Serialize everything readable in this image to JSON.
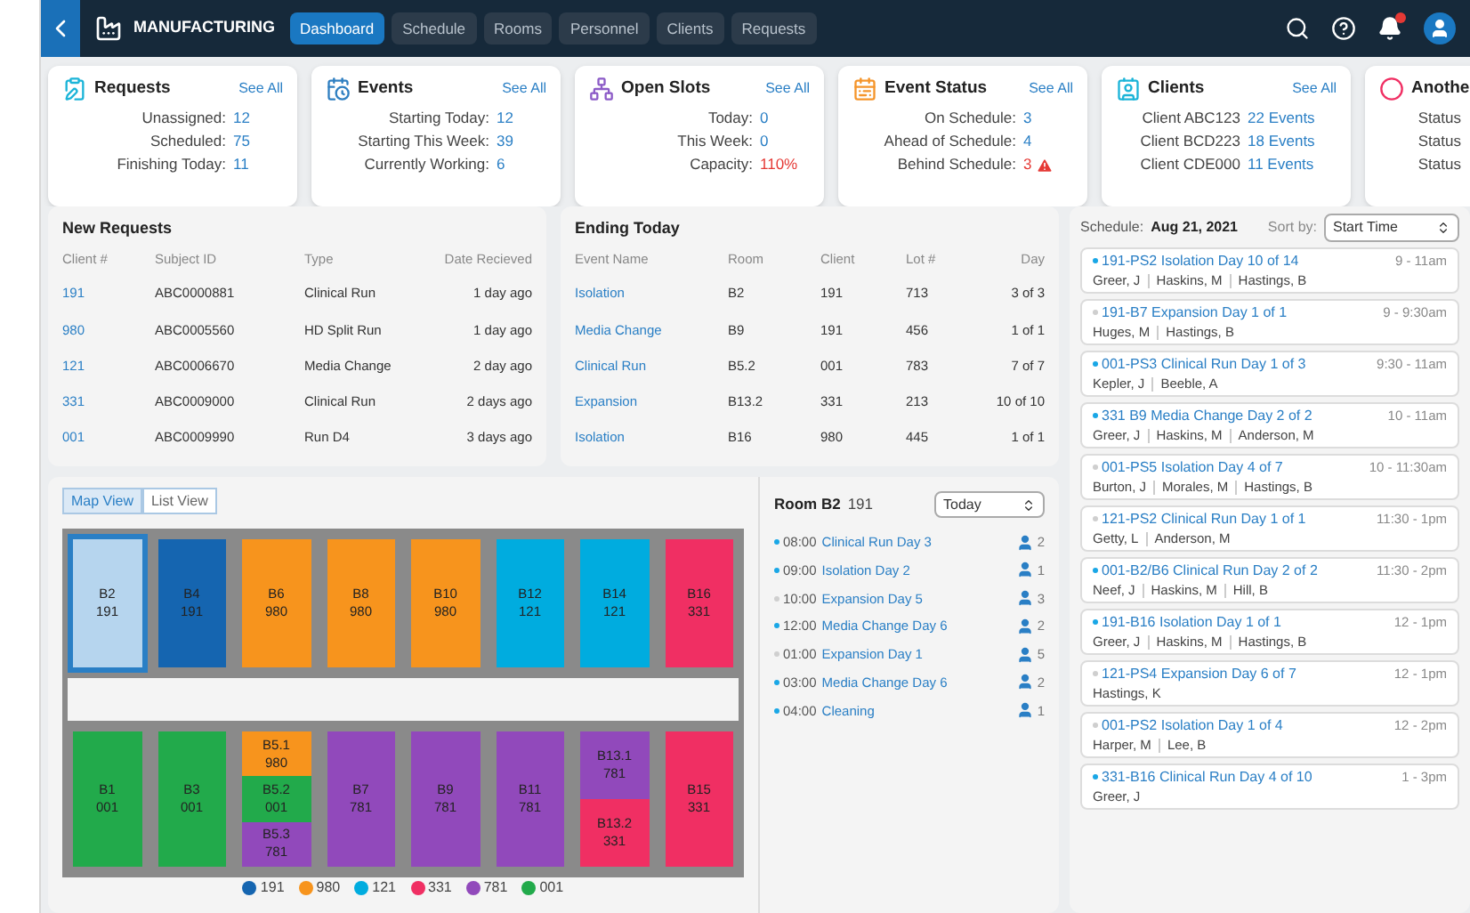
{
  "topbar": {
    "app_name": "MANUFACTURING",
    "tabs": [
      {
        "label": "Dashboard",
        "selected": true
      },
      {
        "label": "Schedule",
        "selected": false
      },
      {
        "label": "Rooms",
        "selected": false
      },
      {
        "label": "Personnel",
        "selected": false
      },
      {
        "label": "Clients",
        "selected": false
      },
      {
        "label": "Requests",
        "selected": false
      }
    ],
    "notification": true
  },
  "cards": [
    {
      "kind": "requests",
      "title": "Requests",
      "link": "See All",
      "rows": [
        {
          "label": "Unassigned:",
          "value": "12",
          "alert": false,
          "warning": false
        },
        {
          "label": "Scheduled:",
          "value": "75",
          "alert": false,
          "warning": false
        },
        {
          "label": "Finishing Today:",
          "value": "11",
          "alert": false,
          "warning": false
        }
      ]
    },
    {
      "kind": "events",
      "title": "Events",
      "link": "See All",
      "rows": [
        {
          "label": "Starting Today:",
          "value": "12",
          "alert": false,
          "warning": false
        },
        {
          "label": "Starting This Week:",
          "value": "39",
          "alert": false,
          "warning": false
        },
        {
          "label": "Currently Working:",
          "value": "6",
          "alert": false,
          "warning": false
        }
      ]
    },
    {
      "kind": "slots",
      "title": "Open Slots",
      "link": "See All",
      "rows": [
        {
          "label": "Today:",
          "value": "0",
          "alert": false,
          "warning": false
        },
        {
          "label": "This Week:",
          "value": "0",
          "alert": false,
          "warning": false
        },
        {
          "label": "Capacity:",
          "value": "110%",
          "alert": true,
          "warning": false
        }
      ]
    },
    {
      "kind": "status",
      "title": "Event Status",
      "link": "See All",
      "rows": [
        {
          "label": "On Schedule:",
          "value": "3",
          "alert": false,
          "warning": false
        },
        {
          "label": "Ahead of Schedule:",
          "value": "4",
          "alert": false,
          "warning": false
        },
        {
          "label": "Behind Schedule:",
          "value": "3",
          "alert": true,
          "warning": true
        }
      ]
    },
    {
      "kind": "clients",
      "title": "Clients",
      "link": "See All",
      "rows": [
        {
          "label": "Client ABC123",
          "value": "22 Events",
          "alert": false,
          "warning": false
        },
        {
          "label": "Client BCD223",
          "value": "18 Events",
          "alert": false,
          "warning": false
        },
        {
          "label": "Client CDE000",
          "value": "11 Events",
          "alert": false,
          "warning": false
        }
      ]
    },
    {
      "kind": "other",
      "title": "Anothe",
      "rows": [
        {
          "label": "Status"
        },
        {
          "label": "Status"
        },
        {
          "label": "Status"
        }
      ]
    }
  ],
  "new_requests": {
    "title": "New Requests",
    "columns": [
      "Client #",
      "Subject ID",
      "Type",
      "Date Recieved"
    ],
    "rows": [
      [
        "191",
        "ABC0000881",
        "Clinical Run",
        "1 day ago"
      ],
      [
        "980",
        "ABC0005560",
        "HD Split Run",
        "1 day ago"
      ],
      [
        "121",
        "ABC0006670",
        "Media Change",
        "2 day ago"
      ],
      [
        "331",
        "ABC0009000",
        "Clinical Run",
        "2 days ago"
      ],
      [
        "001",
        "ABC0009990",
        "Run D4",
        "3 days ago"
      ]
    ]
  },
  "ending_today": {
    "title": "Ending Today",
    "columns": [
      "Event Name",
      "Room",
      "Client",
      "Lot #",
      "Day"
    ],
    "rows": [
      [
        "Isolation",
        "B2",
        "191",
        "713",
        "3 of 3"
      ],
      [
        "Media Change",
        "B9",
        "191",
        "456",
        "1 of 1"
      ],
      [
        "Clinical Run",
        "B5.2",
        "001",
        "783",
        "7 of 7"
      ],
      [
        "Expansion",
        "B13.2",
        "331",
        "213",
        "10 of 10"
      ],
      [
        "Isolation",
        "B16",
        "980",
        "445",
        "1 of 1"
      ]
    ]
  },
  "map": {
    "views": [
      {
        "label": "Map View",
        "selected": true
      },
      {
        "label": "List View",
        "selected": false
      }
    ],
    "rows": [
      [
        {
          "kind": "room",
          "name": "B2",
          "client": "191",
          "color": "#b6d5ee",
          "selected": true
        },
        {
          "kind": "room",
          "name": "B4",
          "client": "191",
          "color": "#1565b0",
          "selected": false
        },
        {
          "kind": "room",
          "name": "B6",
          "client": "980",
          "color": "#f7941d",
          "selected": false
        },
        {
          "kind": "room",
          "name": "B8",
          "client": "980",
          "color": "#f7941d",
          "selected": false
        },
        {
          "kind": "room",
          "name": "B10",
          "client": "980",
          "color": "#f7941d",
          "selected": false
        },
        {
          "kind": "room",
          "name": "B12",
          "client": "121",
          "color": "#00acdf",
          "selected": false
        },
        {
          "kind": "room",
          "name": "B14",
          "client": "121",
          "color": "#00acdf",
          "selected": false
        },
        {
          "kind": "room",
          "name": "B16",
          "client": "331",
          "color": "#f02f63",
          "selected": false
        }
      ],
      [
        {
          "kind": "room",
          "name": "B1",
          "client": "001",
          "color": "#22aa4b",
          "selected": false
        },
        {
          "kind": "room",
          "name": "B3",
          "client": "001",
          "color": "#22aa4b",
          "selected": false
        },
        {
          "kind": "split",
          "parts": [
            {
              "name": "B5.1",
              "client": "980",
              "color": "#f7941d",
              "selected": false
            },
            {
              "name": "B5.2",
              "client": "001",
              "color": "#22aa4b",
              "selected": false
            },
            {
              "name": "B5.3",
              "client": "781",
              "color": "#9149bb",
              "selected": false
            }
          ]
        },
        {
          "kind": "room",
          "name": "B7",
          "client": "781",
          "color": "#9149bb",
          "selected": false
        },
        {
          "kind": "room",
          "name": "B9",
          "client": "781",
          "color": "#9149bb",
          "selected": false
        },
        {
          "kind": "room",
          "name": "B11",
          "client": "781",
          "color": "#9149bb",
          "selected": false
        },
        {
          "kind": "split",
          "parts": [
            {
              "name": "B13.1",
              "client": "781",
              "color": "#9149bb",
              "selected": false
            },
            {
              "name": "B13.2",
              "client": "331",
              "color": "#f02f63",
              "selected": false
            }
          ]
        },
        {
          "kind": "room",
          "name": "B15",
          "client": "331",
          "color": "#f02f63",
          "selected": false
        }
      ]
    ],
    "legend": [
      {
        "label": "191",
        "color": "#1565b0"
      },
      {
        "label": "980",
        "color": "#f7941d"
      },
      {
        "label": "121",
        "color": "#00acdf"
      },
      {
        "label": "331",
        "color": "#f02f63"
      },
      {
        "label": "781",
        "color": "#9149bb"
      },
      {
        "label": "001",
        "color": "#22aa4b"
      }
    ]
  },
  "room_detail": {
    "title": "Room B2",
    "client": "191",
    "period": "Today",
    "events": [
      {
        "time": "08:00",
        "name": "Clinical Run Day 3",
        "count": "2",
        "color": "#1aa7e6"
      },
      {
        "time": "09:00",
        "name": "Isolation Day 2",
        "count": "1",
        "color": "#1aa7e6"
      },
      {
        "time": "10:00",
        "name": "Expansion Day 5",
        "count": "3",
        "color": "#cfcfcf"
      },
      {
        "time": "12:00",
        "name": "Media Change Day 6",
        "count": "2",
        "color": "#1aa7e6"
      },
      {
        "time": "01:00",
        "name": "Expansion Day 1",
        "count": "5",
        "color": "#cfcfcf"
      },
      {
        "time": "03:00",
        "name": "Media Change Day 6",
        "count": "2",
        "color": "#1aa7e6"
      },
      {
        "time": "04:00",
        "name": "Cleaning",
        "count": "1",
        "color": "#1aa7e6"
      }
    ]
  },
  "schedule": {
    "label": "Schedule:",
    "date": "Aug 21, 2021",
    "sort_label": "Sort by:",
    "sort": "Start Time",
    "items": [
      {
        "title": "191-PS2 Isolation Day 10 of 14",
        "time": "9 - 11am",
        "people": [
          "Greer, J",
          "Haskins, M",
          "Hastings, B"
        ],
        "color": "#1aa7e6"
      },
      {
        "title": "191-B7 Expansion Day 1 of 1",
        "time": "9 - 9:30am",
        "people": [
          "Huges, M",
          "Hastings, B"
        ],
        "color": "#cfcfcf"
      },
      {
        "title": "001-PS3 Clinical Run Day 1 of 3",
        "time": "9:30 - 11am",
        "people": [
          "Kepler, J",
          "Beeble, A"
        ],
        "color": "#1aa7e6"
      },
      {
        "title": "331 B9 Media Change Day 2 of 2",
        "time": "10 - 11am",
        "people": [
          "Greer, J",
          "Haskins, M",
          "Anderson, M"
        ],
        "color": "#1aa7e6"
      },
      {
        "title": "001-PS5 Isolation Day 4 of 7",
        "time": "10 - 11:30am",
        "people": [
          "Burton, J",
          "Morales, M",
          "Hastings, B"
        ],
        "color": "#cfcfcf"
      },
      {
        "title": "121-PS2 Clinical Run Day 1 of 1",
        "time": "11:30 - 1pm",
        "people": [
          "Getty, L",
          "Anderson, M"
        ],
        "color": "#cfcfcf"
      },
      {
        "title": "001-B2/B6 Clinical Run Day 2 of 2",
        "time": "11:30 - 2pm",
        "people": [
          "Neef, J",
          "Haskins, M",
          "Hill, B"
        ],
        "color": "#1aa7e6"
      },
      {
        "title": "191-B16 Isolation Day 1 of 1",
        "time": "12 - 1pm",
        "people": [
          "Greer, J",
          "Haskins, M",
          "Hastings, B"
        ],
        "color": "#1aa7e6"
      },
      {
        "title": "121-PS4 Expansion Day 6 of 7",
        "time": "12 - 1pm",
        "people": [
          "Hastings, K"
        ],
        "color": "#cfcfcf"
      },
      {
        "title": "001-PS2 Isolation Day 1 of 4",
        "time": "12 - 2pm",
        "people": [
          "Harper, M",
          "Lee, B"
        ],
        "color": "#cfcfcf"
      },
      {
        "title": "331-B16 Clinical Run Day 4 of 10",
        "time": "1 - 3pm",
        "people": [
          "Greer, J"
        ],
        "color": "#1aa7e6"
      }
    ]
  }
}
